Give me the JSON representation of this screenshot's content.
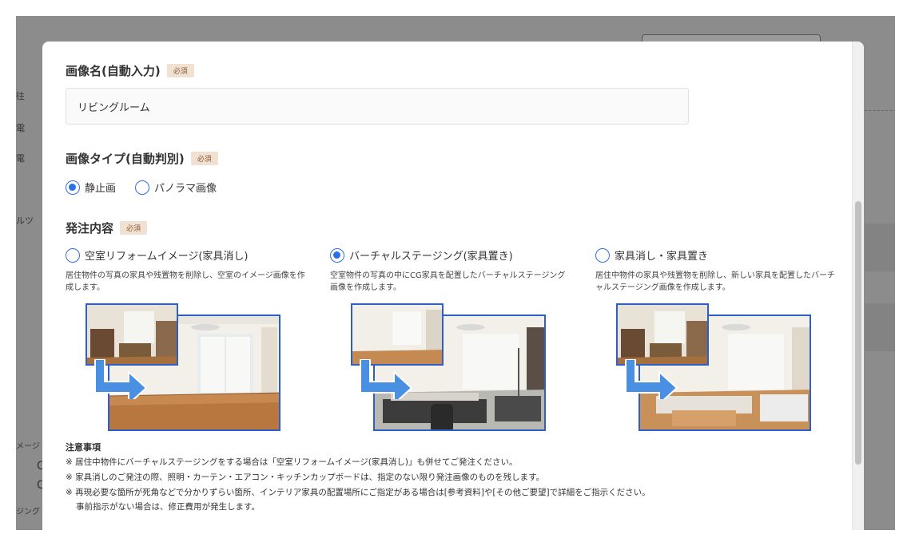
{
  "background_fragments": [
    "往",
    "電",
    "電",
    "ルツ",
    "メージ",
    "C",
    "C",
    "ジング"
  ],
  "image_name": {
    "label": "画像名(自動入力)",
    "badge": "必須",
    "value": "リビングルーム"
  },
  "image_type": {
    "label": "画像タイプ(自動判別)",
    "badge": "必須",
    "options": [
      {
        "label": "静止画",
        "checked": true
      },
      {
        "label": "パノラマ画像",
        "checked": false
      }
    ]
  },
  "order_content": {
    "label": "発注内容",
    "badge": "必須",
    "options": [
      {
        "label": "空室リフォームイメージ(家具消し)",
        "checked": false,
        "desc": "居住物件の写真の家具や残置物を削除し、空室のイメージ画像を作成します。"
      },
      {
        "label": "バーチャルステージング(家具置き)",
        "checked": true,
        "desc": "空室物件の写真の中にCG家具を配置したバーチャルステージング画像を作成します。"
      },
      {
        "label": "家具消し・家具置き",
        "checked": false,
        "desc": "居住中物件の家具や残置物を削除し、新しい家具を配置したバーチャルステージング画像を作成します。"
      }
    ]
  },
  "notes": {
    "title": "注意事項",
    "items": [
      "※ 居住中物件にバーチャルステージングをする場合は「空室リフォームイメージ(家具消し)」も併せてご発注ください。",
      "※ 家具消しのご発注の際、照明・カーテン・エアコン・キッチンカップボードは、指定のない限り発注画像のものを残します。",
      "※ 再現必要な箇所が死角などで分かりずらい箇所、インテリア家具の配置場所にご指定がある場合は[参考資料]や[その他ご要望]で詳細をご指示ください。",
      "事前指示がない場合は、修正費用が発生します。"
    ]
  },
  "colors": {
    "accent": "#2d6fe6",
    "frame": "#2e5fc9",
    "badge_bg": "#f0e1d2",
    "badge_text": "#8a5b38"
  }
}
